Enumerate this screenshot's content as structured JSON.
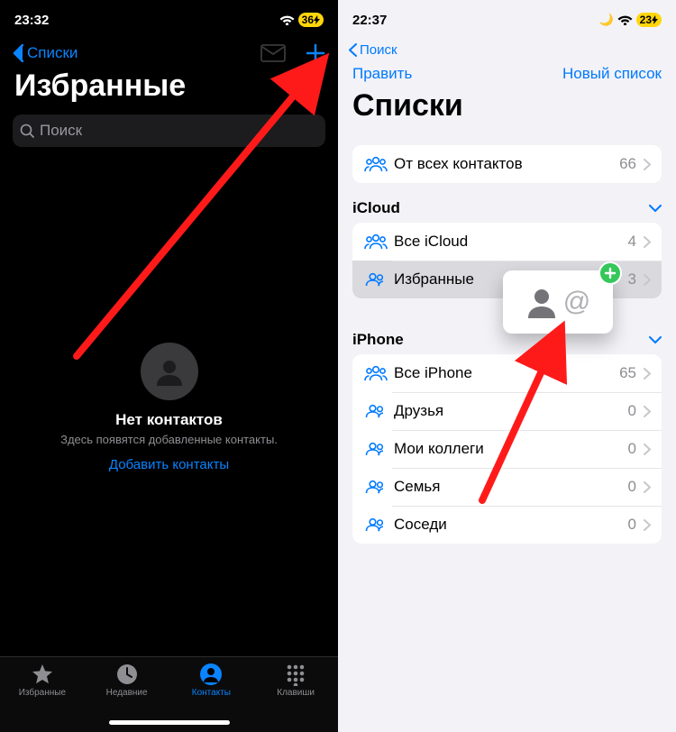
{
  "left": {
    "status": {
      "time": "23:32",
      "battery": "36"
    },
    "back": "Списки",
    "title": "Избранные",
    "search_placeholder": "Поиск",
    "empty": {
      "title": "Нет контактов",
      "subtitle": "Здесь появятся добавленные контакты.",
      "cta": "Добавить контакты"
    },
    "tabs": [
      {
        "label": "Избранные",
        "active": false
      },
      {
        "label": "Недавние",
        "active": false
      },
      {
        "label": "Контакты",
        "active": true
      },
      {
        "label": "Клавиши",
        "active": false
      }
    ]
  },
  "right": {
    "status": {
      "time": "22:37",
      "battery": "23"
    },
    "search_back": "Поиск",
    "edit": "Править",
    "new_list": "Новый список",
    "title": "Списки",
    "all_contacts": {
      "label": "От всех контактов",
      "count": 66
    },
    "sections": [
      {
        "name": "iCloud",
        "rows": [
          {
            "label": "Все iCloud",
            "count": 4,
            "selected": false,
            "icon": "three"
          },
          {
            "label": "Избранные",
            "count": 3,
            "selected": true,
            "icon": "two"
          }
        ]
      },
      {
        "name": "iPhone",
        "rows": [
          {
            "label": "Все iPhone",
            "count": 65,
            "selected": false,
            "icon": "three"
          },
          {
            "label": "Друзья",
            "count": 0,
            "selected": false,
            "icon": "two"
          },
          {
            "label": "Мои коллеги",
            "count": 0,
            "selected": false,
            "icon": "two"
          },
          {
            "label": "Семья",
            "count": 0,
            "selected": false,
            "icon": "two"
          },
          {
            "label": "Соседи",
            "count": 0,
            "selected": false,
            "icon": "two"
          }
        ]
      }
    ],
    "drag_card_at": "@"
  }
}
